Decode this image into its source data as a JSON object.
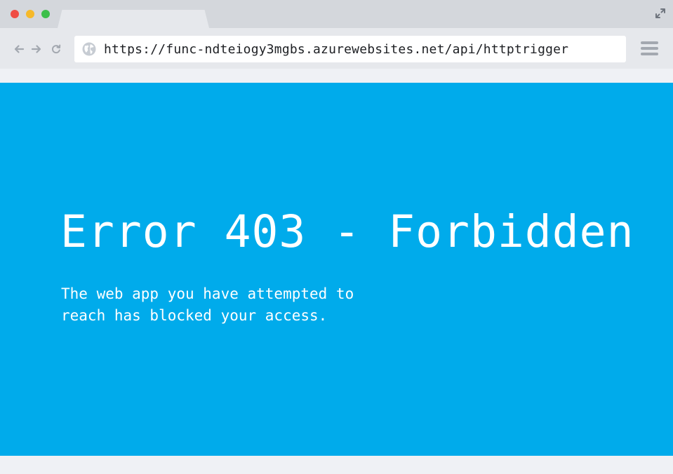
{
  "browser": {
    "url": "https://func-ndteiogy3mgbs.azurewebsites.net/api/httptrigger",
    "icons": {
      "back": "arrow-left-icon",
      "forward": "arrow-right-icon",
      "reload": "reload-icon",
      "site": "globe-icon",
      "menu": "hamburger-menu-icon",
      "expand": "expand-icon"
    },
    "traffic_lights": [
      "#ef4d45",
      "#f6b92a",
      "#3cbf4a"
    ]
  },
  "page": {
    "title": "Error 403 - Forbidden",
    "message": "The web app you have attempted to\nreach has blocked your access.",
    "background_color": "#00abeb",
    "text_color": "#ffffff"
  }
}
